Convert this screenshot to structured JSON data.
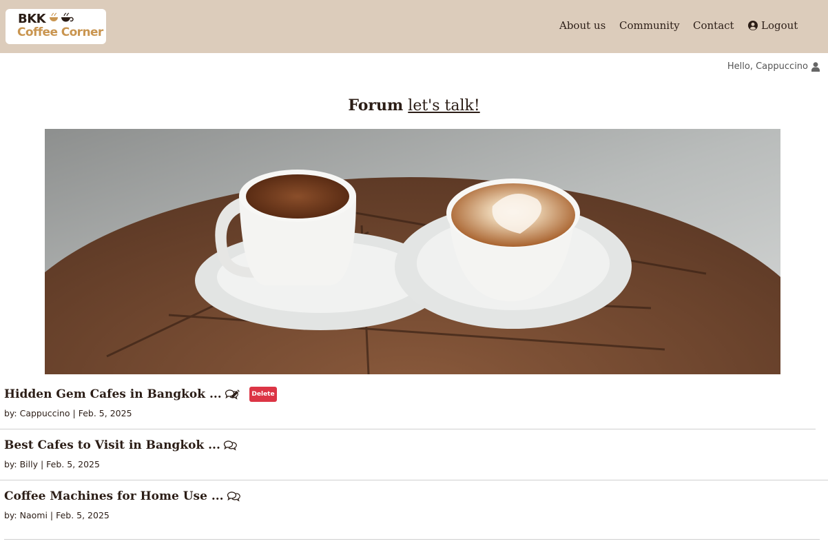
{
  "brand": {
    "line1": "BKK",
    "line2": "Coffee Corner",
    "accent_color": "#c99550",
    "nav_bg": "#dcccbb"
  },
  "nav": {
    "about": "About us",
    "community": "Community",
    "contact": "Contact",
    "logout": "Logout"
  },
  "user": {
    "greeting": "Hello, Cappuccino"
  },
  "forum": {
    "title_bold": "Forum",
    "title_link": "let's talk!"
  },
  "hero": {
    "icon": "coffee-photo"
  },
  "posts": [
    {
      "title": "Hidden Gem Cafes in Bangkok ...",
      "meta": "by: Cappuccino | Feb. 5, 2025",
      "delete_label": "Delete"
    },
    {
      "title": "Best Cafes to Visit in Bangkok ...",
      "meta": "by: Billy | Feb. 5, 2025"
    },
    {
      "title": "Coffee Machines for Home Use ...",
      "meta": "by: Naomi | Feb. 5, 2025"
    }
  ]
}
